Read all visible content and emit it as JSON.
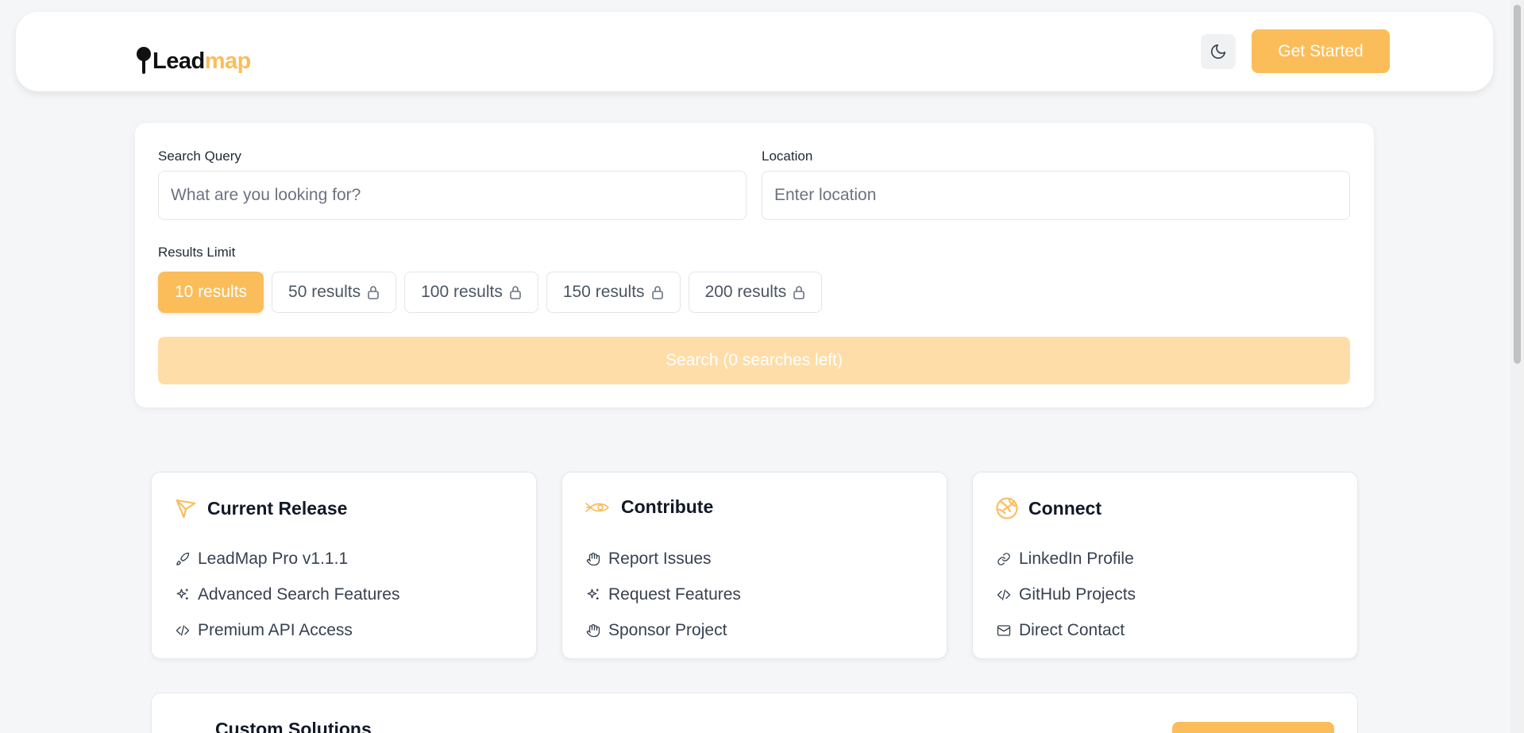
{
  "header": {
    "logo_lead": "Lead",
    "logo_map": "map",
    "cta_label": "Get Started"
  },
  "search": {
    "query_label": "Search Query",
    "query_placeholder": "What are you looking for?",
    "location_label": "Location",
    "location_placeholder": "Enter location",
    "limit_label": "Results Limit",
    "limits": [
      {
        "label": "10 results",
        "locked": false,
        "active": true
      },
      {
        "label": "50 results",
        "locked": true,
        "active": false
      },
      {
        "label": "100 results",
        "locked": true,
        "active": false
      },
      {
        "label": "150 results",
        "locked": true,
        "active": false
      },
      {
        "label": "200 results",
        "locked": true,
        "active": false
      }
    ],
    "button_label": "Search (0 searches left)"
  },
  "cards": [
    {
      "title": "Current Release",
      "icon": "megaphone-icon",
      "items": [
        {
          "label": "LeadMap Pro v1.1.1",
          "icon": "rocket-icon"
        },
        {
          "label": "Advanced Search Features",
          "icon": "sparkles-icon"
        },
        {
          "label": "Premium API Access",
          "icon": "code-icon"
        }
      ]
    },
    {
      "title": "Contribute",
      "icon": "rocket-icon",
      "items": [
        {
          "label": "Report Issues",
          "icon": "hand-icon"
        },
        {
          "label": "Request Features",
          "icon": "sparkles-icon"
        },
        {
          "label": "Sponsor Project",
          "icon": "hand-icon"
        }
      ]
    },
    {
      "title": "Connect",
      "icon": "globe-icon",
      "items": [
        {
          "label": "LinkedIn Profile",
          "icon": "link-icon"
        },
        {
          "label": "GitHub Projects",
          "icon": "code-icon"
        },
        {
          "label": "Direct Contact",
          "icon": "mail-icon"
        }
      ]
    }
  ],
  "bottom": {
    "title": "Custom Solutions"
  },
  "colors": {
    "accent": "#fbbd5a",
    "accent_light": "#fedda8",
    "page_bg": "#f5f6f8"
  }
}
